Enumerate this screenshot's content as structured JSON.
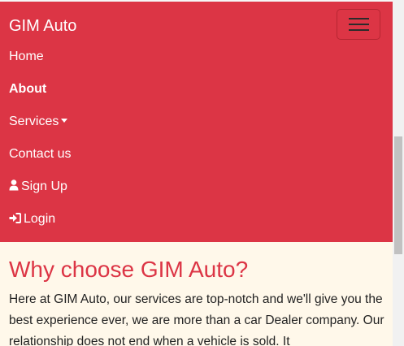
{
  "navbar": {
    "brand": "GIM Auto",
    "accent_color": "#dc3545",
    "toggler_icon": "hamburger-menu-icon",
    "items": [
      {
        "label": "Home",
        "active": false
      },
      {
        "label": "About",
        "active": true
      },
      {
        "label": "Services",
        "active": false,
        "icon": "caret-down-icon"
      },
      {
        "label": "Contact us",
        "active": false
      },
      {
        "label": "Sign Up",
        "active": false,
        "icon": "user-icon"
      },
      {
        "label": "Login",
        "active": false,
        "icon": "sign-in-icon"
      }
    ]
  },
  "main": {
    "heading": "Why choose GIM Auto?",
    "paragraph": "Here at GIM Auto, our services are top-notch and we'll give you the best experience ever, we are more than a car Dealer company. Our relationship does not end when a vehicle is sold. It"
  }
}
